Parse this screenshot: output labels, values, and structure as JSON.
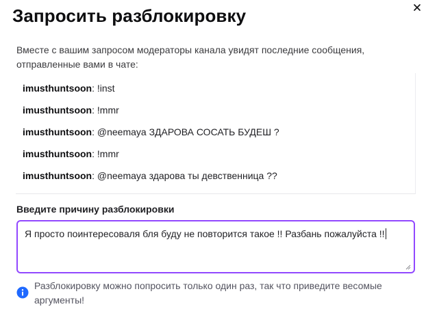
{
  "dialog": {
    "title": "Запросить разблокировку",
    "intro": "Вместе с вашим запросом модераторы канала увидят последние сообщения, отправленные вами в чате:",
    "close_icon": "close-icon"
  },
  "messages": [
    {
      "user": "imusthuntsoon",
      "text": ": !inst"
    },
    {
      "user": "imusthuntsoon",
      "text": ": !mmr"
    },
    {
      "user": "imusthuntsoon",
      "text": ": @neemaya ЗДАРОВА СОСАТЬ БУДЕШ ?"
    },
    {
      "user": "imusthuntsoon",
      "text": ": !mmr"
    },
    {
      "user": "imusthuntsoon",
      "text": ": @neemaya здарова ты девственница ??"
    }
  ],
  "reason": {
    "label": "Введите причину разблокировки",
    "value": "Я просто поинтересоваля бля буду не повторится такое !! Разбань пожалуйста !!"
  },
  "info": {
    "icon": "info-icon",
    "text": "Разблокировку можно попросить только один раз, так что приведите весомые аргументы!"
  },
  "colors": {
    "accent": "#9147ff",
    "info": "#1f69ff"
  }
}
